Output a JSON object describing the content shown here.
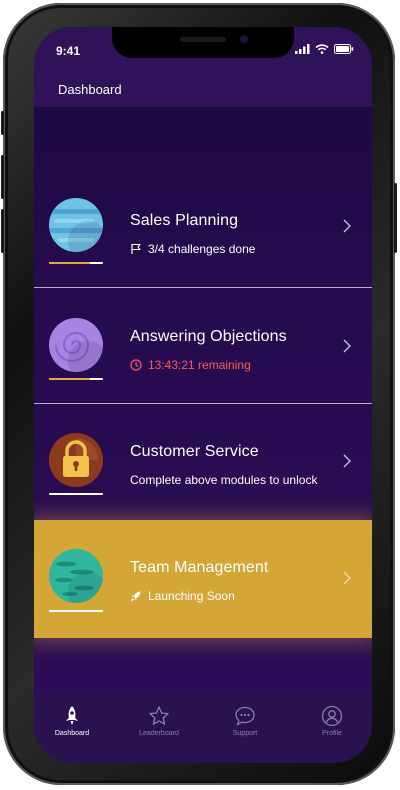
{
  "status_bar": {
    "time": "9:41"
  },
  "header": {
    "title": "Dashboard"
  },
  "modules": [
    {
      "title": "Sales Planning",
      "subtitle": "3/4 challenges done",
      "subtitle_icon": "flag-icon",
      "icon": "blue-planet-icon",
      "progress": 0.75,
      "state": "in-progress"
    },
    {
      "title": "Answering Objections",
      "subtitle": "13:43:21 remaining",
      "subtitle_icon": "clock-icon",
      "icon": "purple-planet-icon",
      "progress": 0.75,
      "state": "timed",
      "subtitle_color": "#ff5a57"
    },
    {
      "title": "Customer Service",
      "subtitle": "Complete above modules to unlock",
      "icon": "lock-icon",
      "progress": 0,
      "state": "locked"
    },
    {
      "title": "Team Management",
      "subtitle": "Launching Soon",
      "subtitle_icon": "rocket-icon",
      "icon": "green-planet-icon",
      "progress": 0,
      "state": "coming-soon",
      "highlight_color": "#d3a635"
    }
  ],
  "tabbar": {
    "tabs": [
      {
        "label": "Dashboard",
        "icon": "rocket-icon",
        "active": true
      },
      {
        "label": "Leaderboard",
        "icon": "star-icon",
        "active": false
      },
      {
        "label": "Support",
        "icon": "chat-bubble-icon",
        "active": false
      },
      {
        "label": "Profile",
        "icon": "user-icon",
        "active": false
      }
    ]
  },
  "colors": {
    "background": "#260b4e",
    "header": "#2f1258",
    "accent": "#d3a635",
    "progress": "#e3a93a",
    "alert": "#ff5a57"
  }
}
